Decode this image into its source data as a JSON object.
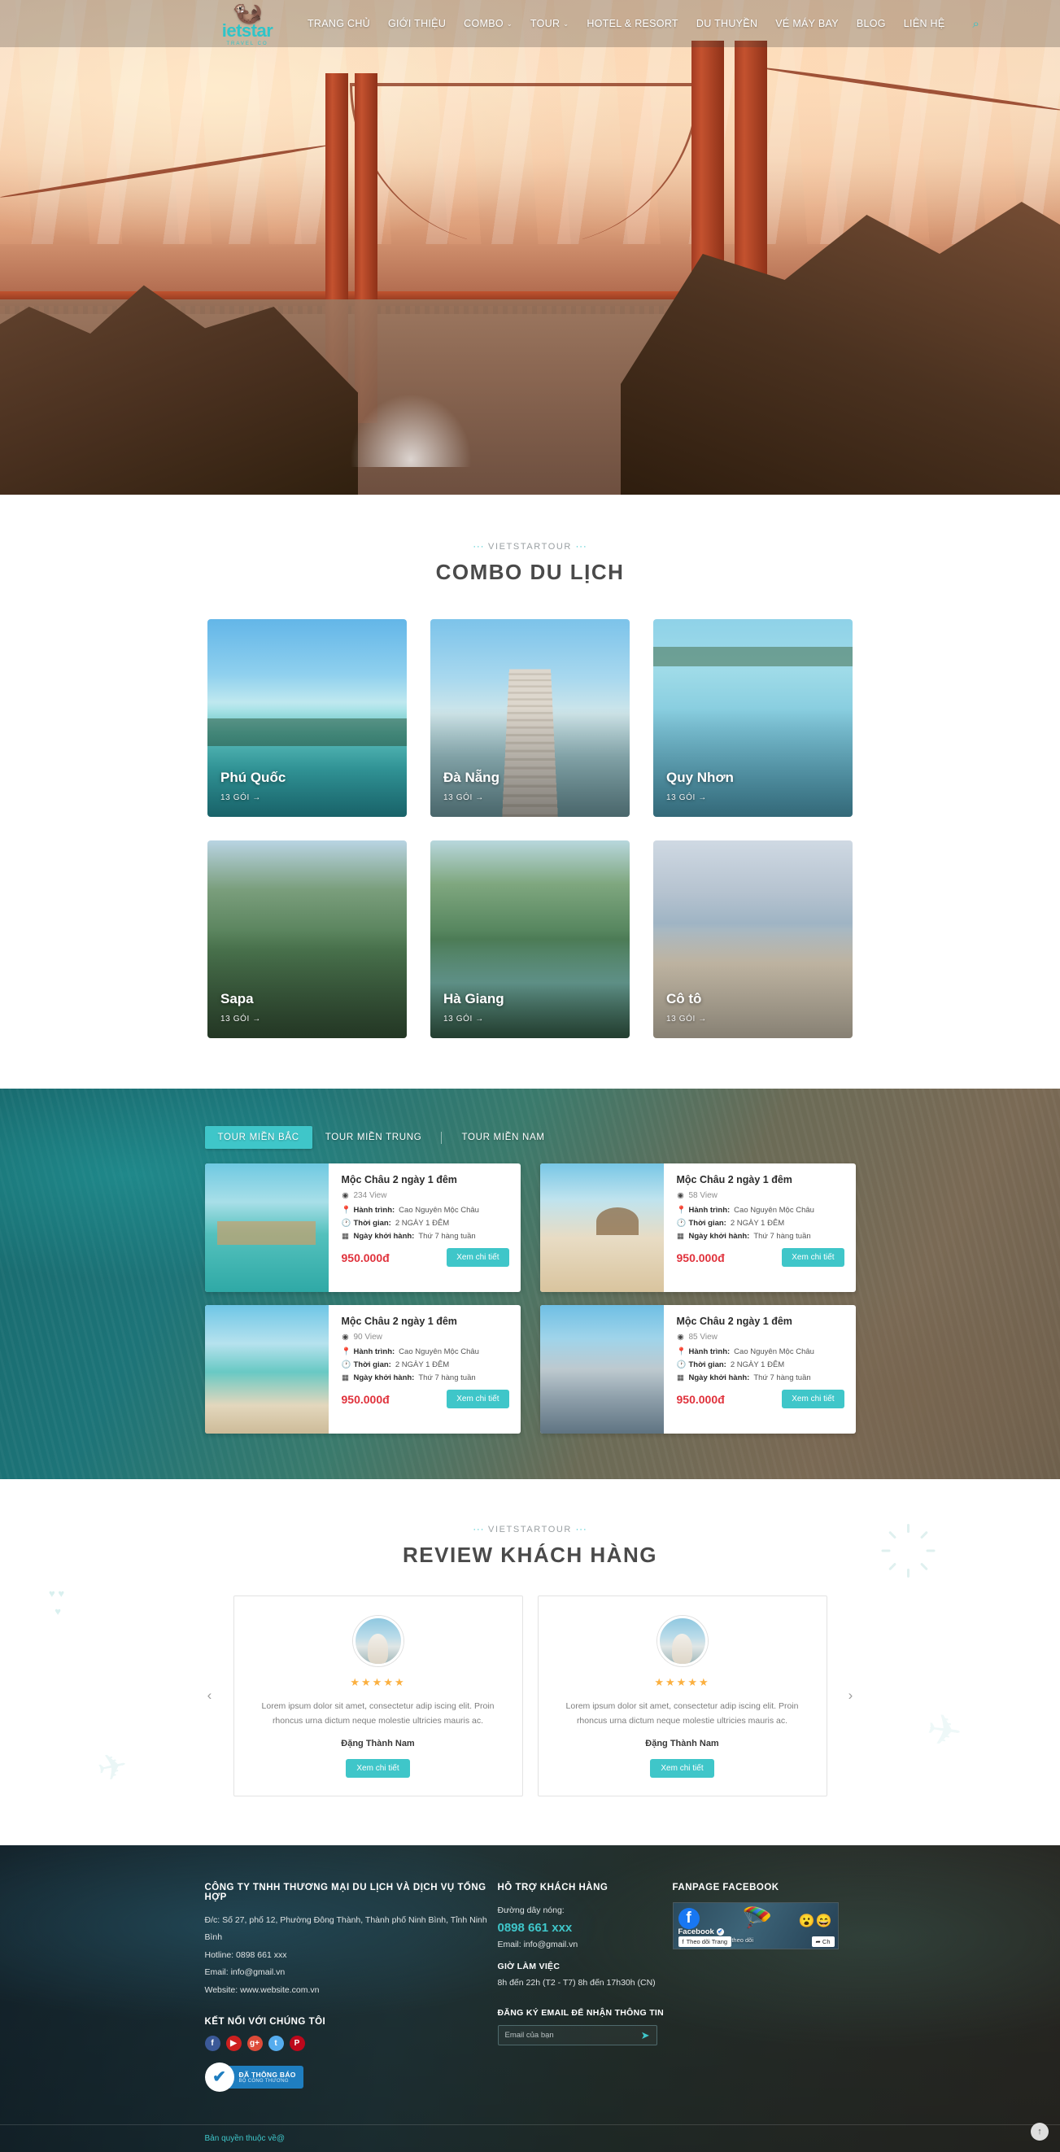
{
  "brand": {
    "logo_text": "ietstar",
    "logo_sub": "TRAVEL CO"
  },
  "nav": {
    "items": [
      {
        "label": "TRANG CHỦ",
        "caret": ""
      },
      {
        "label": "GIỚI THIỆU",
        "caret": ""
      },
      {
        "label": "COMBO",
        "caret": "⌄"
      },
      {
        "label": "TOUR",
        "caret": "⌄"
      },
      {
        "label": "HOTEL & RESORT",
        "caret": ""
      },
      {
        "label": "DU THUYỀN",
        "caret": ""
      },
      {
        "label": "VÉ MÁY BAY",
        "caret": ""
      },
      {
        "label": "BLOG",
        "caret": ""
      },
      {
        "label": "LIÊN HỆ",
        "caret": ""
      }
    ],
    "search_icon": "⌕"
  },
  "combo": {
    "eyebrow": "VIETSTARTOUR",
    "title": "COMBO DU LỊCH",
    "cards": [
      {
        "name": "Phú Quốc",
        "count": "13 GÓI  →",
        "ph": "ph-phuquoc"
      },
      {
        "name": "Đà Nẵng",
        "count": "13 GÓI  →",
        "ph": "ph-danang"
      },
      {
        "name": "Quy Nhơn",
        "count": "13 GÓI  →",
        "ph": "ph-quynhon"
      },
      {
        "name": "Sapa",
        "count": "13 GÓI  →",
        "ph": "ph-sapa"
      },
      {
        "name": "Hà Giang",
        "count": "13 GÓI  →",
        "ph": "ph-hagiang"
      },
      {
        "name": "Cô tô",
        "count": "13 GÓI  →",
        "ph": "ph-coto"
      }
    ]
  },
  "tours": {
    "tabs": [
      {
        "label": "TOUR MIỀN BẮC",
        "active": true
      },
      {
        "label": "TOUR MIỀN TRUNG",
        "active": false
      },
      {
        "label": "TOUR MIỀN NAM",
        "active": false
      }
    ],
    "labels": {
      "route": "Hành trình:",
      "duration": "Thời gian:",
      "departure": "Ngày khởi hành:",
      "view_suffix": "View",
      "button": "Xem chi tiết"
    },
    "cards": [
      {
        "title": "Mộc Châu 2 ngày 1 đêm",
        "views": "234 View",
        "route": "Cao Nguyên Mộc Châu",
        "duration": "2 NGÀY 1 ĐÊM",
        "departure": "Thứ 7 hàng tuần",
        "price": "950.000đ",
        "thumb": "th-a"
      },
      {
        "title": "Mộc Châu 2 ngày 1 đêm",
        "views": "58 View",
        "route": "Cao Nguyên Mộc Châu",
        "duration": "2 NGÀY 1 ĐÊM",
        "departure": "Thứ 7 hàng tuần",
        "price": "950.000đ",
        "thumb": "th-b"
      },
      {
        "title": "Mộc Châu 2 ngày 1 đêm",
        "views": "90 View",
        "route": "Cao Nguyên Mộc Châu",
        "duration": "2 NGÀY 1 ĐÊM",
        "departure": "Thứ 7 hàng tuần",
        "price": "950.000đ",
        "thumb": "th-c"
      },
      {
        "title": "Mộc Châu 2 ngày 1 đêm",
        "views": "85 View",
        "route": "Cao Nguyên Mộc Châu",
        "duration": "2 NGÀY 1 ĐÊM",
        "departure": "Thứ 7 hàng tuần",
        "price": "950.000đ",
        "thumb": "th-d"
      }
    ]
  },
  "reviews": {
    "eyebrow": "VIETSTARTOUR",
    "title": "REVIEW KHÁCH HÀNG",
    "prev": "‹",
    "next": "›",
    "items": [
      {
        "stars": "★★★★★",
        "text": "Lorem ipsum dolor sit amet, consectetur adip iscing elit. Proin rhoncus urna dictum neque molestie ultricies mauris ac.",
        "name": "Đặng Thành Nam",
        "button": "Xem chi tiết"
      },
      {
        "stars": "★★★★★",
        "text": "Lorem ipsum dolor sit amet, consectetur adip iscing elit. Proin rhoncus urna dictum neque molestie ultricies mauris ac.",
        "name": "Đặng Thành Nam",
        "button": "Xem chi tiết"
      }
    ]
  },
  "footer": {
    "company": {
      "heading": "CÔNG TY TNHH THƯƠNG MẠI DU LỊCH VÀ DỊCH VỤ TỔNG HỢP",
      "address": "Đ/c: Số 27, phố 12, Phường Đông Thành, Thành phố Ninh Bình, Tỉnh Ninh Bình",
      "hotline": "Hotline: 0898 661 xxx",
      "email": "Email: info@gmail.vn",
      "website": "Website: www.website.com.vn",
      "connect_heading": "KẾT NỐI VỚI CHÚNG TÔI",
      "socials": [
        {
          "name": "facebook",
          "glyph": "f",
          "cls": "s-fb"
        },
        {
          "name": "youtube",
          "glyph": "▶",
          "cls": "s-yt"
        },
        {
          "name": "google-plus",
          "glyph": "g+",
          "cls": "s-gp"
        },
        {
          "name": "twitter",
          "glyph": "t",
          "cls": "s-tw"
        },
        {
          "name": "pinterest",
          "glyph": "P",
          "cls": "s-pi"
        }
      ],
      "badge_line1": "ĐÃ THÔNG BÁO",
      "badge_line2": "BỘ CÔNG THƯƠNG",
      "badge_check": "✔"
    },
    "support": {
      "heading": "HỖ TRỢ KHÁCH HÀNG",
      "hotline_label": "Đường dây nóng:",
      "hotline": "0898 661 xxx",
      "email": "Email: info@gmail.vn",
      "hours_heading": "GIỜ LÀM VIỆC",
      "hours": "8h đến 22h (T2 - T7) 8h đến 17h30h (CN)",
      "subscribe_heading": "ĐĂNG KÝ EMAIL ĐỂ NHẬN THÔNG TIN",
      "email_placeholder": "Email của bạn",
      "send_icon": "➤"
    },
    "fanpage": {
      "heading": "FANPAGE FACEBOOK",
      "page_name": "Facebook",
      "followers": "188.222.349 người theo dõi",
      "follow_button": "Theo dõi Trang",
      "share_button": "Ch",
      "emojis": "😮😄"
    },
    "copyright": "Bản quyền thuộc về@",
    "totop": "↑"
  },
  "colors": {
    "accent": "#3fc6c9",
    "price": "#e0323c",
    "star": "#fbb040"
  }
}
